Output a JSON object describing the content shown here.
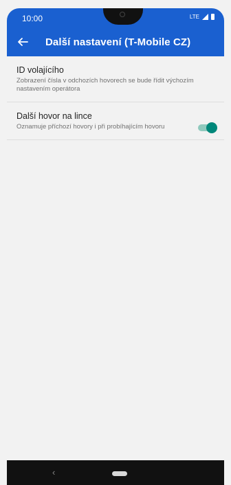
{
  "status_bar": {
    "time": "10:00",
    "network_label": "LTE"
  },
  "app_bar": {
    "title": "Další nastavení (T-Mobile CZ)",
    "back_icon": "arrow-back-icon"
  },
  "settings": [
    {
      "title": "ID volajícího",
      "summary": "Zobrazení čísla v odchozích hovorech se bude řídit výchozím nastavením operátora"
    },
    {
      "title": "Další hovor na lince",
      "summary": "Oznamuje příchozí hovory i při probíhajícím hovoru",
      "toggle_on": true
    }
  ],
  "nav_bar": {
    "back_glyph": "‹"
  },
  "colors": {
    "app_bar": "#1a60d0",
    "toggle_thumb": "#00877a",
    "toggle_track": "#8fc9bd"
  }
}
